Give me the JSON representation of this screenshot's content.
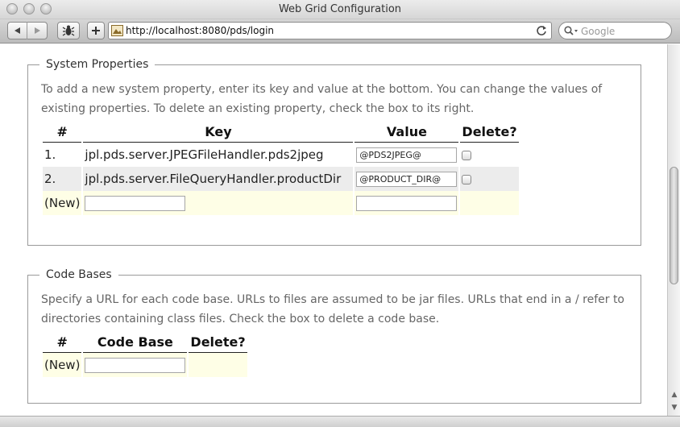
{
  "window": {
    "title": "Web Grid Configuration"
  },
  "toolbar": {
    "url": "http://localhost:8080/pds/login",
    "search_placeholder": "Google"
  },
  "system_properties": {
    "legend": "System Properties",
    "description_line1": "To add a new system property, enter its key and value at the bottom. You can change the values of",
    "description_line2": "existing properties. To delete an existing property, check the box to its right.",
    "headers": {
      "num": "#",
      "key": "Key",
      "value": "Value",
      "delete": "Delete?"
    },
    "rows": [
      {
        "num": "1.",
        "key": "jpl.pds.server.JPEGFileHandler.pds2jpeg",
        "value": "@PDS2JPEG@",
        "checked": false
      },
      {
        "num": "2.",
        "key": "jpl.pds.server.FileQueryHandler.productDir",
        "value": "@PRODUCT_DIR@",
        "checked": false
      }
    ],
    "new_row": {
      "label": "(New)",
      "key_value": "",
      "value_value": ""
    }
  },
  "code_bases": {
    "legend": "Code Bases",
    "description_line1": "Specify a URL for each code base. URLs to files are assumed to be jar files. URLs that end in a / refer to",
    "description_line2": "directories containing class files. Check the box to delete a code base.",
    "headers": {
      "num": "#",
      "code_base": "Code Base",
      "delete": "Delete?"
    },
    "new_row": {
      "label": "(New)",
      "value": ""
    }
  }
}
